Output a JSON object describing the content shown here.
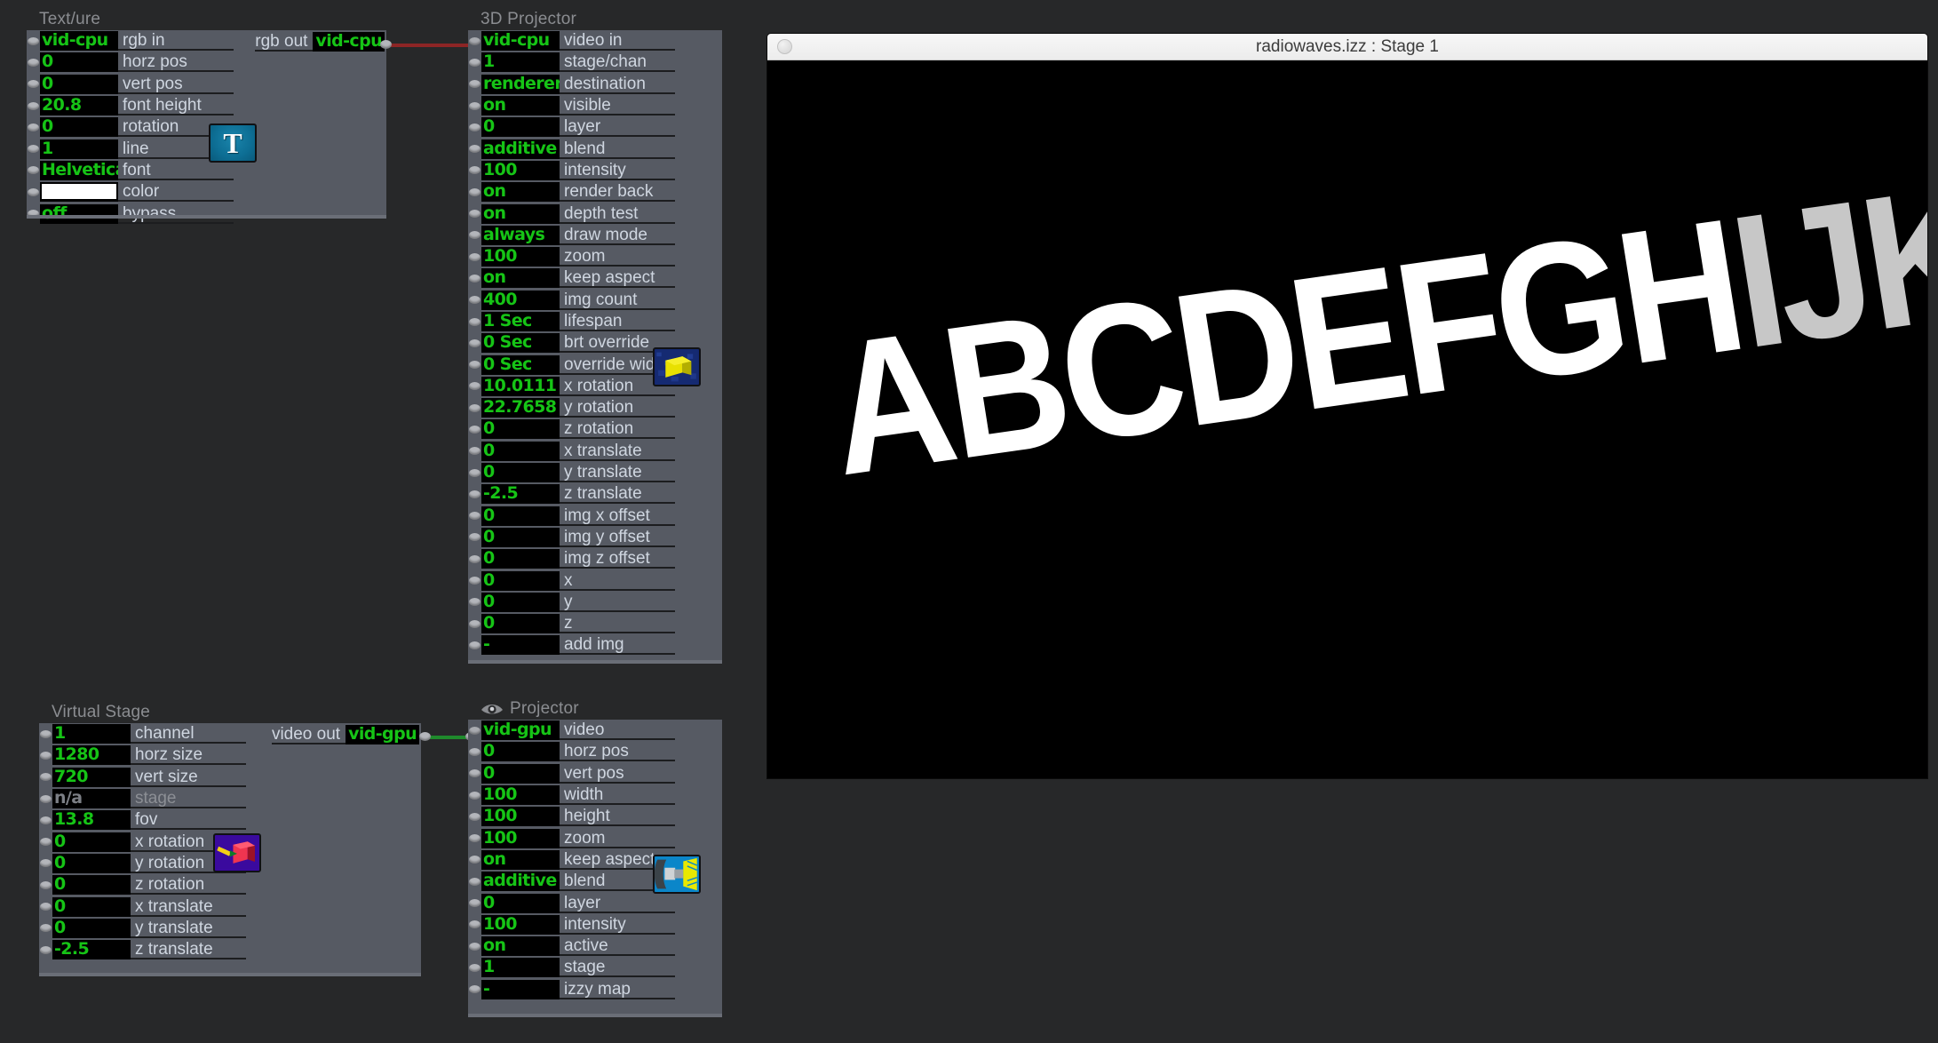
{
  "app": {
    "background_color": "#272829",
    "panel_color": "#565a63",
    "value_text_color": "#16c416",
    "label_text_color": "#cfd6e0"
  },
  "modules": [
    {
      "id": "texture",
      "title": "Text/ure",
      "icon_name": "text-t-icon",
      "icon_glyph": "T",
      "output": {
        "label": "rgb out",
        "value": "vid-cpu"
      },
      "params": [
        {
          "label": "rgb in",
          "value": "vid-cpu",
          "type": "text"
        },
        {
          "label": "horz pos",
          "value": "0",
          "type": "text"
        },
        {
          "label": "vert pos",
          "value": "0",
          "type": "text"
        },
        {
          "label": "font height",
          "value": "20.8",
          "type": "text"
        },
        {
          "label": "rotation",
          "value": "0",
          "type": "text"
        },
        {
          "label": "line",
          "value": "1",
          "type": "text"
        },
        {
          "label": "font",
          "value": "Helvetica",
          "type": "text"
        },
        {
          "label": "color",
          "value": "#ffffff",
          "type": "swatch"
        },
        {
          "label": "bypass",
          "value": "off",
          "type": "text"
        }
      ]
    },
    {
      "id": "projector3d",
      "title": "3D Projector",
      "icon_name": "yellow-cube-icon",
      "params": [
        {
          "label": "video in",
          "value": "vid-cpu",
          "type": "text",
          "connected": true
        },
        {
          "label": "stage/chan",
          "value": "1",
          "type": "text"
        },
        {
          "label": "destination",
          "value": "renderer",
          "type": "text"
        },
        {
          "label": "visible",
          "value": "on",
          "type": "text"
        },
        {
          "label": "layer",
          "value": "0",
          "type": "text"
        },
        {
          "label": "blend",
          "value": "additive",
          "type": "text"
        },
        {
          "label": "intensity",
          "value": "100",
          "type": "text"
        },
        {
          "label": "render back",
          "value": "on",
          "type": "text"
        },
        {
          "label": "depth test",
          "value": "on",
          "type": "text"
        },
        {
          "label": "draw mode",
          "value": "always",
          "type": "text"
        },
        {
          "label": "zoom",
          "value": "100",
          "type": "text"
        },
        {
          "label": "keep aspect",
          "value": "on",
          "type": "text"
        },
        {
          "label": "img count",
          "value": "400",
          "type": "text"
        },
        {
          "label": "lifespan",
          "value": "1 Sec",
          "type": "text"
        },
        {
          "label": "brt override",
          "value": "0 Sec",
          "type": "text"
        },
        {
          "label": "override wid",
          "value": "0 Sec",
          "type": "text"
        },
        {
          "label": "x rotation",
          "value": "10.0111",
          "type": "text"
        },
        {
          "label": "y rotation",
          "value": "22.7658",
          "type": "text"
        },
        {
          "label": "z rotation",
          "value": "0",
          "type": "text"
        },
        {
          "label": "x translate",
          "value": "0",
          "type": "text"
        },
        {
          "label": "y translate",
          "value": "0",
          "type": "text"
        },
        {
          "label": "z translate",
          "value": "-2.5",
          "type": "text"
        },
        {
          "label": "img x offset",
          "value": "0",
          "type": "text"
        },
        {
          "label": "img y offset",
          "value": "0",
          "type": "text"
        },
        {
          "label": "img z offset",
          "value": "0",
          "type": "text"
        },
        {
          "label": "x",
          "value": "0",
          "type": "text"
        },
        {
          "label": "y",
          "value": "0",
          "type": "text"
        },
        {
          "label": "z",
          "value": "0",
          "type": "text"
        },
        {
          "label": "add img",
          "value": "-",
          "type": "text"
        }
      ]
    },
    {
      "id": "virtualstage",
      "title": "Virtual Stage",
      "icon_name": "red-cube-arrow-icon",
      "output": {
        "label": "video out",
        "value": "vid-gpu"
      },
      "params": [
        {
          "label": "channel",
          "value": "1",
          "type": "text"
        },
        {
          "label": "horz size",
          "value": "1280",
          "type": "text"
        },
        {
          "label": "vert size",
          "value": "720",
          "type": "text"
        },
        {
          "label": "stage",
          "value": "n/a",
          "type": "text",
          "dim": true
        },
        {
          "label": "fov",
          "value": "13.8",
          "type": "text"
        },
        {
          "label": "x rotation",
          "value": "0",
          "type": "text"
        },
        {
          "label": "y rotation",
          "value": "0",
          "type": "text"
        },
        {
          "label": "z rotation",
          "value": "0",
          "type": "text"
        },
        {
          "label": "x translate",
          "value": "0",
          "type": "text"
        },
        {
          "label": "y translate",
          "value": "0",
          "type": "text"
        },
        {
          "label": "z translate",
          "value": "-2.5",
          "type": "text"
        }
      ]
    },
    {
      "id": "projector",
      "title": "Projector",
      "title_icon_name": "eye-icon",
      "icon_name": "projector-lamp-icon",
      "params": [
        {
          "label": "video",
          "value": "vid-gpu",
          "type": "text",
          "connected": true
        },
        {
          "label": "horz pos",
          "value": "0",
          "type": "text"
        },
        {
          "label": "vert pos",
          "value": "0",
          "type": "text"
        },
        {
          "label": "width",
          "value": "100",
          "type": "text"
        },
        {
          "label": "height",
          "value": "100",
          "type": "text"
        },
        {
          "label": "zoom",
          "value": "100",
          "type": "text"
        },
        {
          "label": "keep aspect",
          "value": "on",
          "type": "text"
        },
        {
          "label": "blend",
          "value": "additive",
          "type": "text"
        },
        {
          "label": "layer",
          "value": "0",
          "type": "text"
        },
        {
          "label": "intensity",
          "value": "100",
          "type": "text"
        },
        {
          "label": "active",
          "value": "on",
          "type": "text"
        },
        {
          "label": "stage",
          "value": "1",
          "type": "text"
        },
        {
          "label": "izzy map",
          "value": "-",
          "type": "text"
        }
      ]
    }
  ],
  "wires": [
    {
      "name": "texture-to-3dprojector",
      "color": "#8d2525"
    },
    {
      "name": "virtualstage-to-projector",
      "color": "#1f8a2c"
    }
  ],
  "stage_window": {
    "title": "radiowaves.izz : Stage 1",
    "close_button_name": "close-button",
    "canvas_background": "#000000",
    "rendered_text": "ABCDEFGH",
    "rendered_text_tail": "IJK"
  }
}
